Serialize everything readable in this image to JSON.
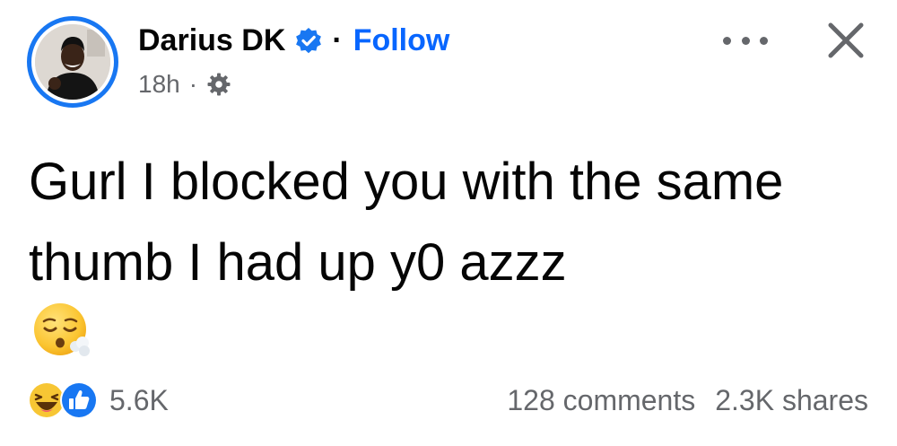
{
  "post": {
    "author": {
      "name": "Darius DK",
      "verified": true,
      "separator": "·",
      "follow_label": "Follow"
    },
    "meta": {
      "time": "18h",
      "separator": "·",
      "privacy_icon": "gear-icon"
    },
    "text": "Gurl I blocked you with the same thumb I had up y0 azzz",
    "emoji": "face-exhaling-emoji",
    "reactions": {
      "icons": [
        "haha-reaction-icon",
        "like-reaction-icon"
      ],
      "count": "5.6K"
    },
    "comments": "128 comments",
    "shares": "2.3K shares"
  },
  "colors": {
    "accent": "#0866ff",
    "verified_badge": "#1877f2",
    "secondary_text": "#65676b",
    "primary_text": "#050505"
  }
}
